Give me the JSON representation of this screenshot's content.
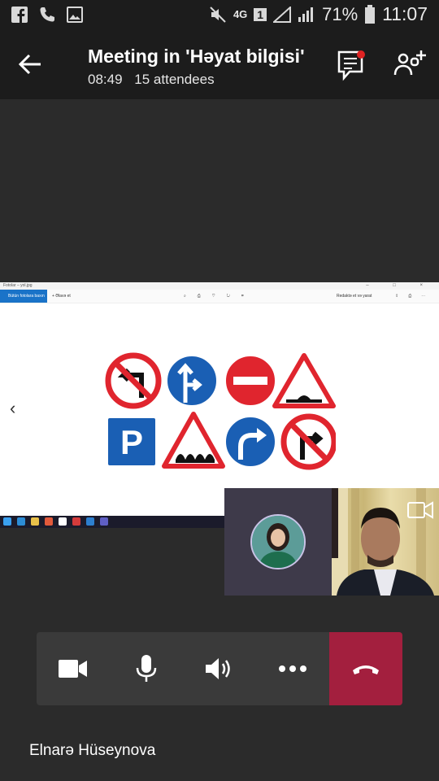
{
  "status_bar": {
    "network": "4G",
    "sim": "1",
    "battery_percent": "71%",
    "time": "11:07"
  },
  "header": {
    "title": "Meeting in 'Həyat bilgisi'",
    "duration": "08:49",
    "attendees": "15 attendees"
  },
  "shared_screen": {
    "window_title": "Fotolar – yol.jpg",
    "window_controls": "– □ ×",
    "toolbar": {
      "collection": "Bütün fotolara baxın",
      "add": "+ Əlavə et",
      "edit": "Redaktə et və yarat"
    },
    "signs": [
      "no-left-turn",
      "straight-or-right",
      "no-entry",
      "bump-warning",
      "parking",
      "uneven-road-warning",
      "turn-right",
      "no-right-turn"
    ],
    "parking_letter": "P",
    "colors": {
      "sign_red": "#e0252e",
      "sign_blue": "#1a5fb4"
    }
  },
  "participants": {
    "self_name": "Elnarə Hüseynova"
  },
  "controls": {
    "camera": "video-camera-icon",
    "mic": "microphone-icon",
    "speaker": "speaker-icon",
    "more": "more-icon",
    "hangup": "hang-up-icon",
    "hangup_color": "#a31f3e"
  }
}
